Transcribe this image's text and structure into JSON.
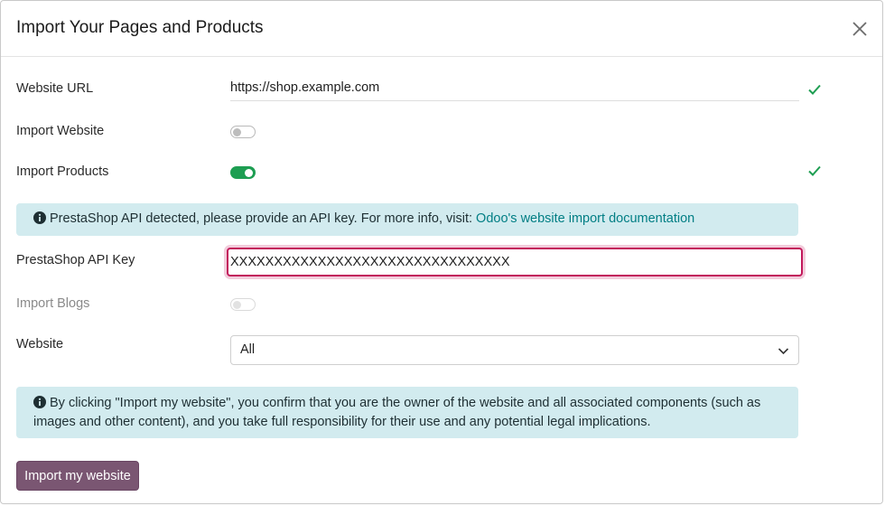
{
  "dialog": {
    "title": "Import Your Pages and Products"
  },
  "fields": {
    "website_url": {
      "label": "Website URL",
      "value": "https://shop.example.com"
    },
    "import_website": {
      "label": "Import Website",
      "enabled": false
    },
    "import_products": {
      "label": "Import Products",
      "enabled": true
    },
    "api_key": {
      "label": "PrestaShop API Key",
      "value": "XXXXXXXXXXXXXXXXXXXXXXXXXXXXXXXX"
    },
    "import_blogs": {
      "label": "Import Blogs",
      "enabled": false,
      "disabled": true
    },
    "website": {
      "label": "Website",
      "selected": "All"
    }
  },
  "alerts": {
    "api_detected": {
      "text": "PrestaShop API detected, please provide an API key. For more info, visit: ",
      "link_text": "Odoo's website import documentation"
    },
    "disclaimer": {
      "text": "By clicking \"Import my website\", you confirm that you are the owner of the website and all associated components (such as images and other content), and you take full responsibility for their use and any potential legal implications."
    }
  },
  "actions": {
    "import_label": "Import my website"
  },
  "colors": {
    "primary": "#7a5672",
    "success": "#1e9e52",
    "info_bg": "#d2ebef",
    "link": "#017e84",
    "focus_border": "#c2185b"
  },
  "icons": {
    "close": "close-icon",
    "check": "check-icon",
    "info": "info-circle-icon",
    "chevron": "chevron-down-icon"
  }
}
